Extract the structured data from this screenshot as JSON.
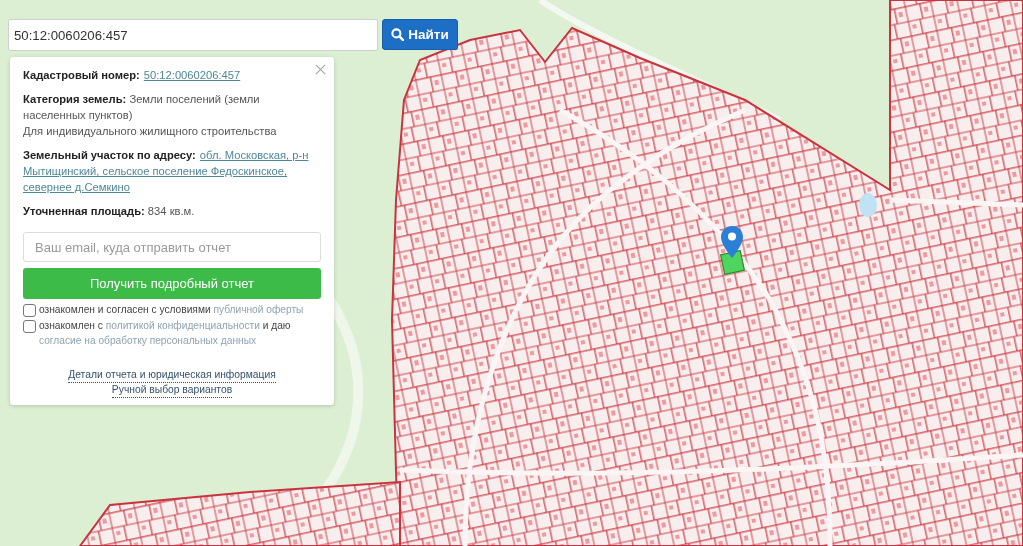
{
  "search": {
    "value": "50:12:0060206:457",
    "button": "Найти"
  },
  "panel": {
    "fields": [
      {
        "kind": "link",
        "label": "Кадастровый номер:",
        "lines": [
          "50:12:0060206:457"
        ]
      },
      {
        "kind": "text",
        "text": "**Категория земель:** Земли поселений (земли населенных пунктов)"
      },
      {
        "kind": "note",
        "text": "Для индивидуального жилищного строительства"
      },
      {
        "kind": "link",
        "label": "Земельный участок по адресу:",
        "lines": [
          "обл. Московская, р-н",
          "Мытищинский, сельское поселение Федоскинское,",
          "севернее д.Семкино"
        ]
      },
      {
        "kind": "text",
        "text": "**Уточненная площадь:** 834 кв.м."
      }
    ],
    "email": {
      "placeholder": "Ваш email, куда отправить отчет"
    },
    "submit": "Получить подробный отчет",
    "consents": [
      {
        "checked": false,
        "parts": [
          {
            "kind": "text",
            "text": "ознакомлен и согласен с условиями"
          },
          {
            "kind": "link",
            "text": "публичной оферты"
          }
        ]
      },
      {
        "checked": false,
        "parts": [
          {
            "kind": "text",
            "text": "ознакомлен с"
          },
          {
            "kind": "link",
            "text": "политикой конфиденциальности"
          },
          {
            "kind": "text",
            "text": "и даю"
          },
          {
            "kind": "link",
            "text": "согласие на обработку персональных данных"
          }
        ]
      }
    ],
    "links": [
      "Детали отчета и юридическая информация",
      "Ручной выбор вариантов"
    ]
  }
}
